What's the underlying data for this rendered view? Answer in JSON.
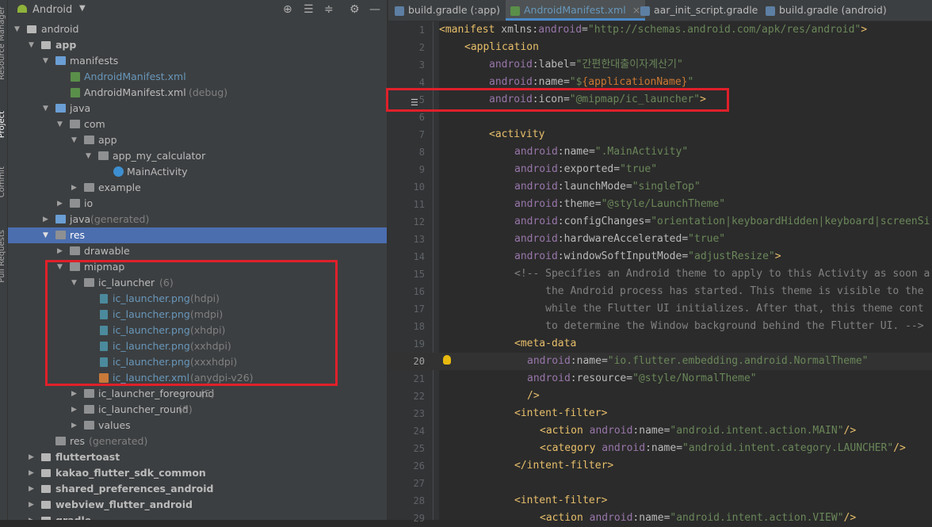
{
  "sidebar_stripe": [
    "Resource Manager",
    "Project",
    "Commit",
    "Pull Requests"
  ],
  "project_panel": {
    "title": "Android",
    "view_icons": [
      "locate-icon",
      "collapse-all-icon",
      "expand-all-icon",
      "gear-icon",
      "hide-icon"
    ],
    "tree": [
      {
        "label": "android",
        "bold": true
      },
      {
        "label": "app",
        "bold": true
      },
      {
        "label": "manifests"
      },
      {
        "label": "AndroidManifest.xml",
        "link": true
      },
      {
        "label": "AndroidManifest.xml",
        "hint": "(debug)"
      },
      {
        "label": "java"
      },
      {
        "label": "com"
      },
      {
        "label": "app"
      },
      {
        "label": "app_my_calculator"
      },
      {
        "label": "MainActivity"
      },
      {
        "label": "example"
      },
      {
        "label": "io"
      },
      {
        "label": "java",
        "hint": "(generated)"
      },
      {
        "label": "res",
        "selected": true
      },
      {
        "label": "drawable"
      },
      {
        "label": "mipmap"
      },
      {
        "label": "ic_launcher",
        "hint": "(6)"
      },
      {
        "label": "ic_launcher.png",
        "hint": "(hdpi)",
        "link": true
      },
      {
        "label": "ic_launcher.png",
        "hint": "(mdpi)",
        "link": true
      },
      {
        "label": "ic_launcher.png",
        "hint": "(xhdpi)",
        "link": true
      },
      {
        "label": "ic_launcher.png",
        "hint": "(xxhdpi)",
        "link": true
      },
      {
        "label": "ic_launcher.png",
        "hint": "(xxxhdpi)",
        "link": true
      },
      {
        "label": "ic_launcher.xml",
        "hint": "(anydpi-v26)",
        "link": true
      },
      {
        "label": "ic_launcher_foreground",
        "hint": "(5)"
      },
      {
        "label": "ic_launcher_round",
        "hint": "(6)"
      },
      {
        "label": "values"
      },
      {
        "label": "res",
        "hint": "(generated)"
      },
      {
        "label": "fluttertoast",
        "bold": true
      },
      {
        "label": "kakao_flutter_sdk_common",
        "bold": true
      },
      {
        "label": "shared_preferences_android",
        "bold": true
      },
      {
        "label": "webview_flutter_android",
        "bold": true
      },
      {
        "label": "gradle",
        "bold": true
      }
    ]
  },
  "editor_tabs": [
    {
      "label": "build.gradle (:app)"
    },
    {
      "label": "AndroidManifest.xml",
      "active": true
    },
    {
      "label": "aar_init_script.gradle"
    },
    {
      "label": "build.gradle (android)"
    }
  ],
  "code_lines": [
    "1",
    "2",
    "3",
    "4",
    "5",
    "6",
    "7",
    "8",
    "9",
    "10",
    "11",
    "12",
    "13",
    "14",
    "15",
    "16",
    "17",
    "18",
    "19",
    "20",
    "21",
    "22",
    "23",
    "24",
    "25",
    "26",
    "27",
    "28",
    "29"
  ],
  "code": {
    "l1_tag": "<manifest",
    "l1_ns": "xmlns",
    "l1_colon": ":",
    "l1_attr": "android",
    "l1_eq": "=",
    "l1_val": "\"http://schemas.android.com/apk/res/android\"",
    "l1_end": ">",
    "l2_tag": "<application",
    "l3_ns": "android",
    "l3_attr": ":label",
    "l3_val": "\"간편한대출이자계산기\"",
    "l4_ns": "android",
    "l4_attr": ":name",
    "l4_val_a": "\"$",
    "l4_val_ph": "{applicationName}",
    "l4_val_b": "\"",
    "l5_ns": "android",
    "l5_attr": ":icon",
    "l5_val": "\"@mipmap/ic_launcher\"",
    "l5_end": ">",
    "l7_tag": "<activity",
    "l8_ns": "android",
    "l8_attr": ":name",
    "l8_val": "\".MainActivity\"",
    "l9_ns": "android",
    "l9_attr": ":exported",
    "l9_val": "\"true\"",
    "l10_ns": "android",
    "l10_attr": ":launchMode",
    "l10_val": "\"singleTop\"",
    "l11_ns": "android",
    "l11_attr": ":theme",
    "l11_val": "\"@style/LaunchTheme\"",
    "l12_ns": "android",
    "l12_attr": ":configChanges",
    "l12_val": "\"orientation|keyboardHidden|keyboard|screenSi",
    "l13_ns": "android",
    "l13_attr": ":hardwareAccelerated",
    "l13_val": "\"true\"",
    "l14_ns": "android",
    "l14_attr": ":windowSoftInputMode",
    "l14_val": "\"adjustResize\"",
    "l14_end": ">",
    "l15": "<!-- Specifies an Android theme to apply to this Activity as soon a",
    "l16": "     the Android process has started. This theme is visible to the",
    "l17": "     while the Flutter UI initializes. After that, this theme cont",
    "l18": "     to determine the Window background behind the Flutter UI. -->",
    "l19_tag": "<meta-data",
    "l20_ns": "android",
    "l20_attr": ":name",
    "l20_val": "\"io.flutter.embedding.android.NormalTheme\"",
    "l21_ns": "android",
    "l21_attr": ":resource",
    "l21_val": "\"@style/NormalTheme\"",
    "l22": "/>",
    "l23_tag": "<intent-filter>",
    "l24_tag": "<action",
    "l24_ns": "android",
    "l24_attr": ":name",
    "l24_val": "\"android.intent.action.MAIN\"",
    "l24_end": "/>",
    "l25_tag": "<category",
    "l25_ns": "android",
    "l25_attr": ":name",
    "l25_val": "\"android.intent.category.LAUNCHER\"",
    "l25_end": "/>",
    "l26_tag": "</intent-filter>",
    "l28_tag": "<intent-filter>",
    "l29_tag": "<action",
    "l29_ns": "android",
    "l29_attr": ":name",
    "l29_val": "\"android.intent.action.VIEW\"",
    "l29_end": "/>"
  },
  "colors": {
    "highlight_box": "#e0202a",
    "selection": "#4b6eaf",
    "accent_tab": "#4a88c7"
  }
}
